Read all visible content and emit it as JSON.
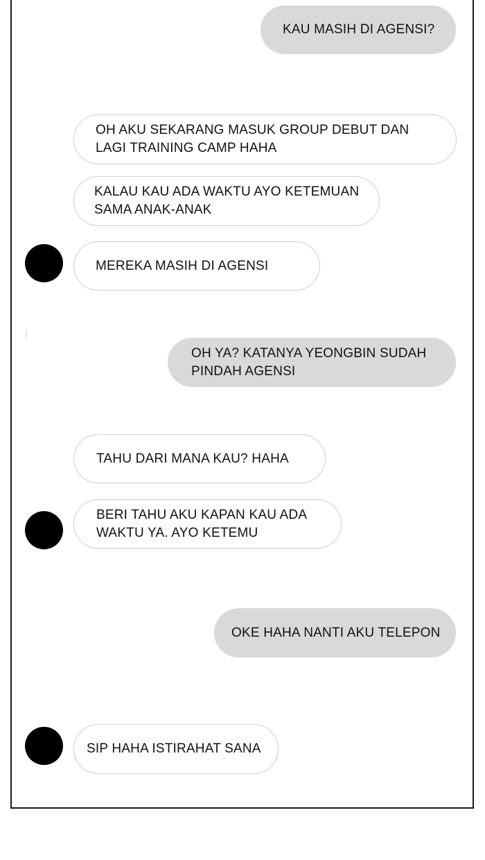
{
  "conversation": {
    "messages": [
      {
        "sender": "me",
        "text": "KAU MASIH DI AGENSI?"
      },
      {
        "sender": "friend",
        "text": "OH AKU SEKARANG MASUK GROUP DEBUT DAN\nLAGI TRAINING CAMP HAHA"
      },
      {
        "sender": "friend",
        "text": "KALAU KAU ADA WAKTU AYO KETEMUAN\nSAMA ANAK-ANAK"
      },
      {
        "sender": "friend",
        "text": "MEREKA MASIH DI AGENSI"
      },
      {
        "sender": "me",
        "text": "OH YA? KATANYA YEONGBIN SUDAH\nPINDAH AGENSI"
      },
      {
        "sender": "friend",
        "text": "TAHU DARI MANA KAU? HAHA"
      },
      {
        "sender": "friend",
        "text": "BERI TAHU AKU KAPAN KAU ADA\nWAKTU YA. AYO KETEMU"
      },
      {
        "sender": "me",
        "text": "OKE HAHA NANTI AKU TELEPON"
      },
      {
        "sender": "friend",
        "text": "SIP HAHA ISTIRAHAT SANA"
      }
    ]
  },
  "colors": {
    "sent_bubble": "#d9d9d9",
    "received_bubble": "#ffffff",
    "received_border": "#cfcfcf",
    "avatar": "#000000",
    "frame": "#1a1a1a"
  }
}
